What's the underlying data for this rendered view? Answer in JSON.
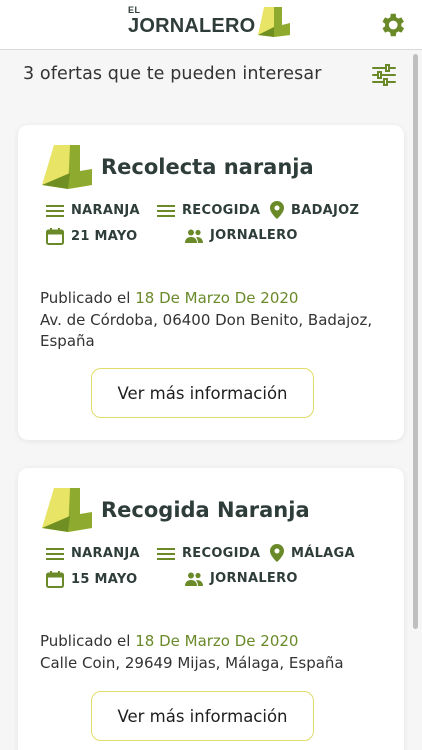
{
  "header": {
    "logo_small": "EL",
    "logo_name": "JORNALERO",
    "settings_icon": "gear-icon"
  },
  "results": {
    "summary": "3 ofertas que te pueden interesar",
    "filter_icon": "sliders-icon"
  },
  "colors": {
    "brand_green": "#6a8a2a",
    "brand_yellow": "#e2dc6a",
    "dark_text": "#2e3d3a"
  },
  "offers": [
    {
      "title": "Recolecta naranja",
      "tags": {
        "product": "NARANJA",
        "task": "RECOGIDA",
        "province": "BADAJOZ",
        "date": "21 MAYO",
        "role": "JORNALERO"
      },
      "published_label": "Publicado el",
      "published_date": "18 De Marzo De 2020",
      "address": "Av. de Córdoba, 06400 Don Benito, Badajoz, España",
      "button": "Ver más información"
    },
    {
      "title": "Recogida Naranja",
      "tags": {
        "product": "NARANJA",
        "task": "RECOGIDA",
        "province": "MÁLAGA",
        "date": "15 MAYO",
        "role": "JORNALERO"
      },
      "published_label": "Publicado el",
      "published_date": "18 De Marzo De 2020",
      "address": "Calle Coin, 29649 Mijas, Málaga, España",
      "button": "Ver más información"
    }
  ]
}
